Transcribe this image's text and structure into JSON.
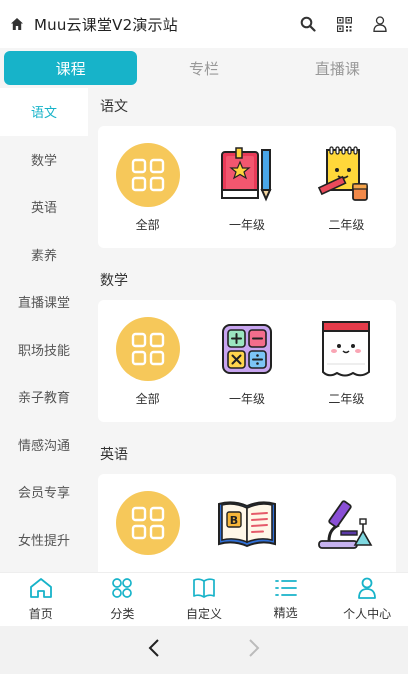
{
  "header": {
    "title": "Muu云课堂V2演示站"
  },
  "tabs": [
    {
      "label": "课程"
    },
    {
      "label": "专栏"
    },
    {
      "label": "直播课"
    }
  ],
  "sidebar": {
    "items": [
      {
        "label": "语文"
      },
      {
        "label": "数学"
      },
      {
        "label": "英语"
      },
      {
        "label": "素养"
      },
      {
        "label": "直播课堂"
      },
      {
        "label": "职场技能"
      },
      {
        "label": "亲子教育"
      },
      {
        "label": "情感沟通"
      },
      {
        "label": "会员专享"
      },
      {
        "label": "女性提升"
      }
    ]
  },
  "sections": [
    {
      "title": "语文",
      "items": [
        {
          "label": "全部"
        },
        {
          "label": "一年级"
        },
        {
          "label": "二年级"
        }
      ]
    },
    {
      "title": "数学",
      "items": [
        {
          "label": "全部"
        },
        {
          "label": "一年级"
        },
        {
          "label": "二年级"
        }
      ]
    },
    {
      "title": "英语",
      "items": [
        {
          "label": ""
        },
        {
          "label": ""
        },
        {
          "label": ""
        }
      ]
    }
  ],
  "bottom_nav": [
    {
      "label": "首页"
    },
    {
      "label": "分类"
    },
    {
      "label": "自定义"
    },
    {
      "label": "精选"
    },
    {
      "label": "个人中心"
    }
  ],
  "colors": {
    "accent": "#17b3c9",
    "all_circle": "#f6c85a",
    "nav_icon": "#17b3c9"
  }
}
